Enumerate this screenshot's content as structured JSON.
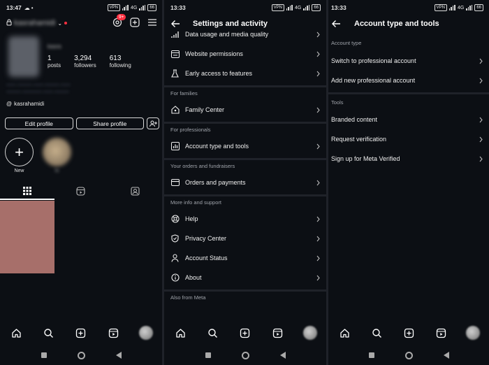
{
  "panel1": {
    "status_time": "13:47",
    "username": "kasrahamidi",
    "threads_badge": "9+",
    "profile_name": "kasra",
    "stats": [
      {
        "num": "1",
        "label": "posts"
      },
      {
        "num": "3,294",
        "label": "followers"
      },
      {
        "num": "613",
        "label": "following"
      }
    ],
    "bio_line1": "—— ——— —— ——— ——",
    "bio_line2": "——— ———— —— ———",
    "handle": "kasrahamidi",
    "edit_profile": "Edit profile",
    "share_profile": "Share profile",
    "highlight_new": "New",
    "highlight_2": "hi"
  },
  "panel2": {
    "status_time": "13:33",
    "title": "Settings and activity",
    "items_top": [
      {
        "label": "Data usage and media quality",
        "icon": "data-usage-icon"
      },
      {
        "label": "Website permissions",
        "icon": "website-permissions-icon"
      },
      {
        "label": "Early access to features",
        "icon": "flask-icon"
      }
    ],
    "section_families": "For families",
    "family_center": "Family Center",
    "section_professionals": "For professionals",
    "account_type_tools": "Account type and tools",
    "section_orders": "Your orders and fundraisers",
    "orders_payments": "Orders and payments",
    "section_more": "More info and support",
    "help": "Help",
    "privacy_center": "Privacy Center",
    "account_status": "Account Status",
    "about": "About",
    "section_meta": "Also from Meta"
  },
  "panel3": {
    "status_time": "13:33",
    "title": "Account type and tools",
    "section_account_type": "Account type",
    "switch_professional": "Switch to professional account",
    "add_professional": "Add new professional account",
    "section_tools": "Tools",
    "branded_content": "Branded content",
    "request_verification": "Request verification",
    "meta_verified": "Sign up for Meta Verified"
  },
  "statusbar": {
    "vpn": "VPN",
    "net": "4G",
    "battery": "66"
  }
}
